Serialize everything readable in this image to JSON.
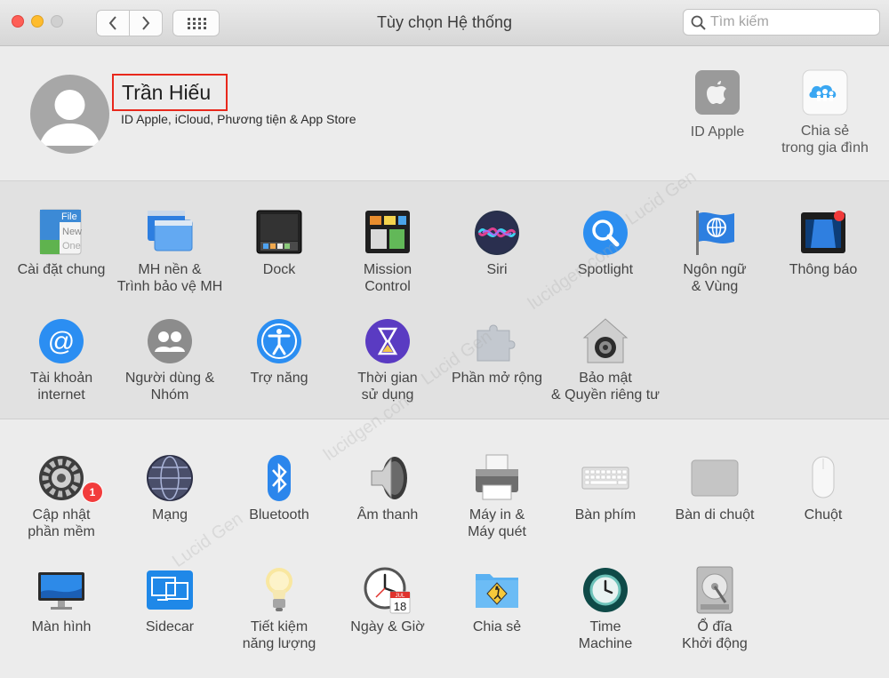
{
  "window": {
    "title": "Tùy chọn Hệ thống"
  },
  "search": {
    "placeholder": "Tìm kiếm"
  },
  "account": {
    "name": "Trần Hiếu",
    "subtitle": "ID Apple, iCloud, Phương tiện & App Store",
    "items": [
      {
        "label": "ID Apple",
        "icon": "apple-icon"
      },
      {
        "label": "Chia sẻ\ntrong gia đình",
        "icon": "family-sharing-icon"
      }
    ]
  },
  "row1": [
    {
      "label": "Cài đặt chung",
      "icon": "general-icon"
    },
    {
      "label": "MH nền &\nTrình bảo vệ MH",
      "icon": "desktop-screensaver-icon"
    },
    {
      "label": "Dock",
      "icon": "dock-icon"
    },
    {
      "label": "Mission\nControl",
      "icon": "mission-control-icon"
    },
    {
      "label": "Siri",
      "icon": "siri-icon"
    },
    {
      "label": "Spotlight",
      "icon": "spotlight-icon"
    },
    {
      "label": "Ngôn ngữ\n& Vùng",
      "icon": "language-region-icon"
    },
    {
      "label": "Thông báo",
      "icon": "notifications-icon"
    }
  ],
  "row2": [
    {
      "label": "Tài khoản\ninternet",
      "icon": "internet-accounts-icon"
    },
    {
      "label": "Người dùng &\nNhóm",
      "icon": "users-groups-icon"
    },
    {
      "label": "Trợ năng",
      "icon": "accessibility-icon"
    },
    {
      "label": "Thời gian\nsử dụng",
      "icon": "screen-time-icon"
    },
    {
      "label": "Phần mở rộng",
      "icon": "extensions-icon"
    },
    {
      "label": "Bảo mật\n& Quyền riêng tư",
      "icon": "security-privacy-icon"
    }
  ],
  "row3": [
    {
      "label": "Cập nhật\nphần mềm",
      "icon": "software-update-icon",
      "badge": "1"
    },
    {
      "label": "Mạng",
      "icon": "network-icon"
    },
    {
      "label": "Bluetooth",
      "icon": "bluetooth-icon"
    },
    {
      "label": "Âm thanh",
      "icon": "sound-icon"
    },
    {
      "label": "Máy in &\nMáy quét",
      "icon": "printers-scanners-icon"
    },
    {
      "label": "Bàn phím",
      "icon": "keyboard-icon"
    },
    {
      "label": "Bàn di chuột",
      "icon": "trackpad-icon"
    },
    {
      "label": "Chuột",
      "icon": "mouse-icon"
    }
  ],
  "row4": [
    {
      "label": "Màn hình",
      "icon": "displays-icon"
    },
    {
      "label": "Sidecar",
      "icon": "sidecar-icon"
    },
    {
      "label": "Tiết kiệm\nnăng lượng",
      "icon": "energy-saver-icon"
    },
    {
      "label": "Ngày & Giờ",
      "icon": "date-time-icon",
      "icon_text": [
        "JUL",
        "18"
      ]
    },
    {
      "label": "Chia sẻ",
      "icon": "sharing-icon"
    },
    {
      "label": "Time\nMachine",
      "icon": "time-machine-icon"
    },
    {
      "label": "Ổ đĩa\nKhởi động",
      "icon": "startup-disk-icon"
    }
  ],
  "general_icon_text": [
    "File",
    "New",
    "One"
  ],
  "watermark": "Lucid Gen",
  "watermark_alt": "lucidgen.com",
  "colors": {
    "accent": "#2f8ef4",
    "badge": "#f23c3c",
    "highlight_box": "#e8281c"
  }
}
